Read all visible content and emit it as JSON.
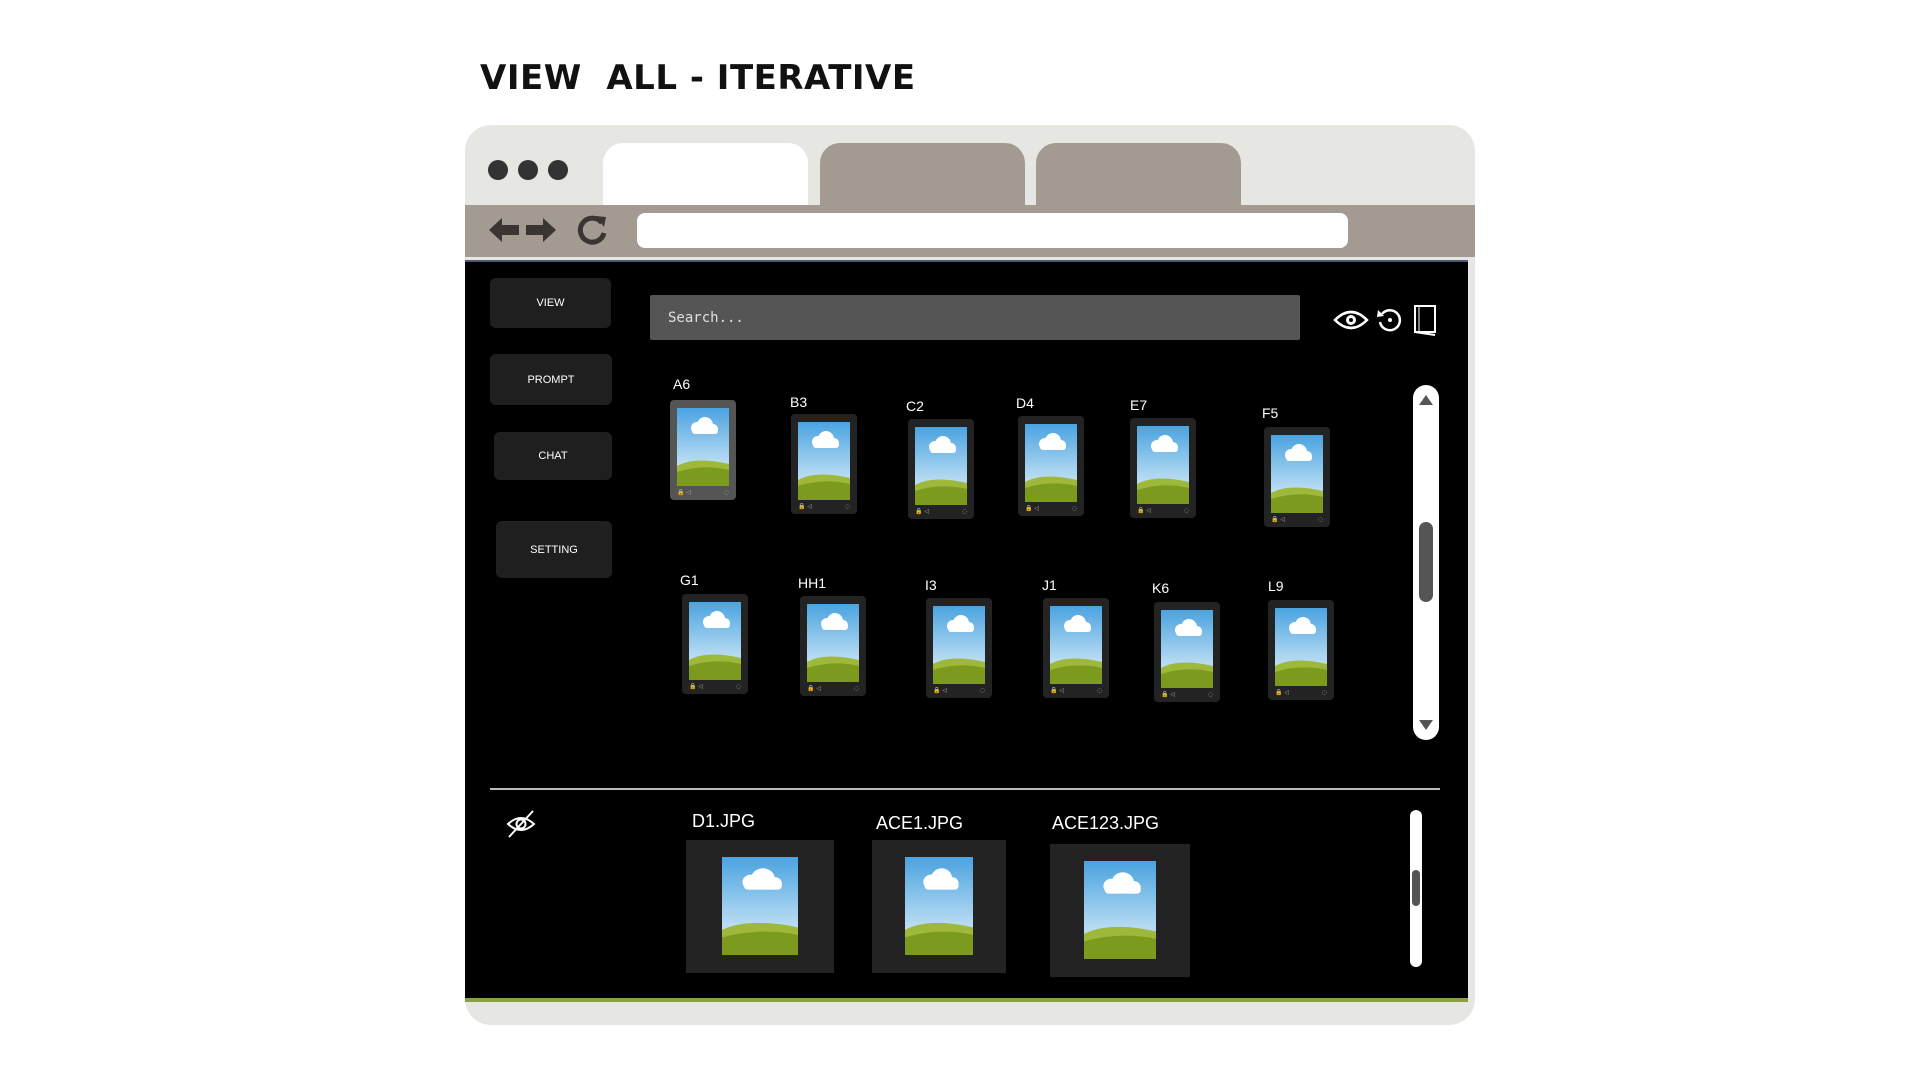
{
  "page_title": "VIEW  ALL - ITERATIVE",
  "sidebar": {
    "view_label": "VIEW",
    "prompt_label": "PROMPT",
    "chat_label": "CHAT",
    "setting_label": "SETTING"
  },
  "search": {
    "placeholder": "Search..."
  },
  "toolbar_icons": [
    "eye-icon",
    "history-icon",
    "book-icon"
  ],
  "grid": {
    "row1": [
      "A6",
      "B3",
      "C2",
      "D4",
      "E7",
      "F5"
    ],
    "row2": [
      "G1",
      "HH1",
      "I3",
      "J1",
      "K6",
      "L9"
    ],
    "selected": "A6"
  },
  "hidden_panel": {
    "icon": "eye-slash-icon",
    "files": [
      "D1.JPG",
      "ACE1.JPG",
      "ACE123.JPG"
    ]
  },
  "colors": {
    "app_bg": "#000000",
    "card_bg": "#232323",
    "browser_chrome": "#e6e6e2",
    "tab_inactive": "#a39a92",
    "sky": "#bfe0f5",
    "grass": "#7c9a1e"
  }
}
